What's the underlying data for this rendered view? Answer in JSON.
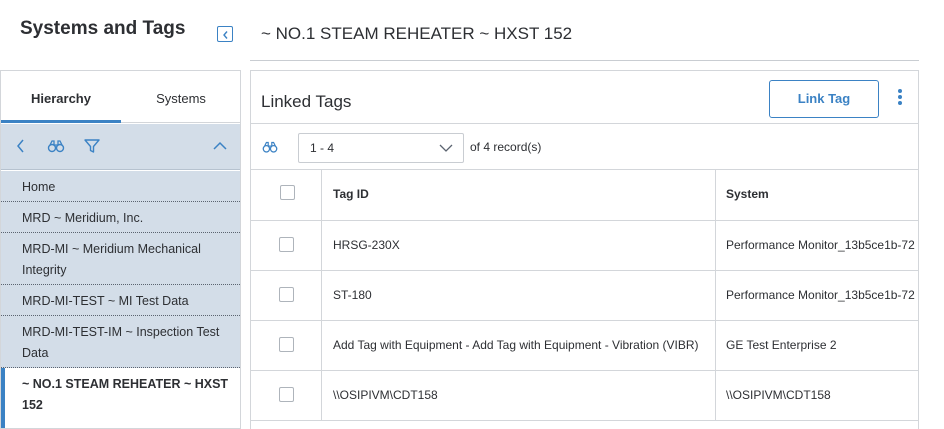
{
  "sidebar": {
    "title": "Systems and Tags",
    "tabs": [
      {
        "label": "Hierarchy",
        "active": true
      },
      {
        "label": "Systems",
        "active": false
      }
    ],
    "toolbar_icons": [
      "back-icon",
      "binoculars-icon",
      "filter-icon",
      "chevron-up-icon"
    ],
    "tree_items": [
      {
        "label": "Home"
      },
      {
        "label": "MRD ~ Meridium, Inc."
      },
      {
        "label": "MRD-MI ~ Meridium Mechanical Integrity"
      },
      {
        "label": "MRD-MI-TEST ~ MI Test Data"
      },
      {
        "label": "MRD-MI-TEST-IM ~ Inspection Test Data"
      },
      {
        "label": "~ NO.1 STEAM REHEATER ~ HXST 152",
        "selected": true
      }
    ]
  },
  "main": {
    "title": "~ NO.1 STEAM REHEATER ~ HXST 152",
    "section_title": "Linked Tags",
    "link_button": "Link Tag",
    "pager": {
      "range": "1 - 4",
      "of": "of",
      "total": "4",
      "records_label": "record(s)"
    },
    "columns": [
      "Tag ID",
      "System"
    ],
    "rows": [
      {
        "tag_id": "HRSG-230X",
        "system": "Performance Monitor_13b5ce1b-72"
      },
      {
        "tag_id": "ST-180",
        "system": "Performance Monitor_13b5ce1b-72"
      },
      {
        "tag_id": "Add Tag with Equipment - Add Tag with Equipment - Vibration (VIBR)",
        "system": "GE Test Enterprise 2"
      },
      {
        "tag_id": "\\\\OSIPIVM\\CDT158",
        "system": "\\\\OSIPIVM\\CDT158"
      }
    ]
  },
  "colors": {
    "accent": "#3b82c4",
    "tree_bg": "#d3dde8",
    "border": "#d3d6da"
  }
}
